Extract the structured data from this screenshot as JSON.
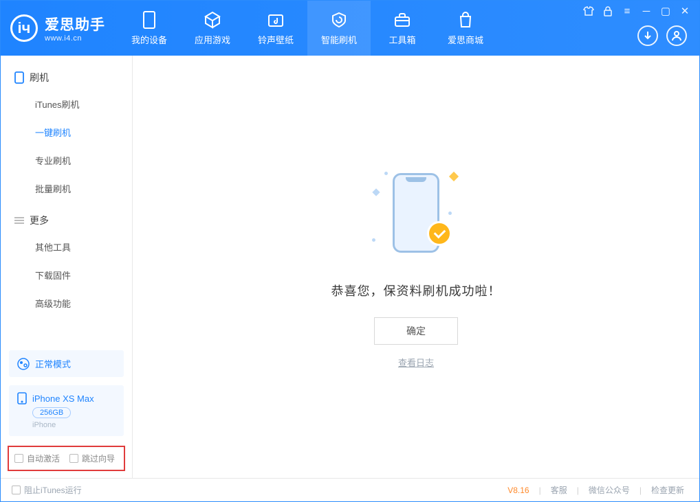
{
  "brand": {
    "title": "爱思助手",
    "sub": "www.i4.cn"
  },
  "nav": {
    "items": [
      {
        "label": "我的设备"
      },
      {
        "label": "应用游戏"
      },
      {
        "label": "铃声壁纸"
      },
      {
        "label": "智能刷机"
      },
      {
        "label": "工具箱"
      },
      {
        "label": "爱思商城"
      }
    ],
    "active_index": 3
  },
  "sidebar": {
    "sec1": "刷机",
    "items1": [
      "iTunes刷机",
      "一键刷机",
      "专业刷机",
      "批量刷机"
    ],
    "active1": 1,
    "sec2": "更多",
    "items2": [
      "其他工具",
      "下载固件",
      "高级功能"
    ]
  },
  "mode": {
    "label": "正常模式"
  },
  "device": {
    "name": "iPhone XS Max",
    "storage": "256GB",
    "type": "iPhone"
  },
  "options": {
    "auto_activate": "自动激活",
    "skip_guide": "跳过向导"
  },
  "main": {
    "success": "恭喜您，保资料刷机成功啦！",
    "ok": "确定",
    "log": "查看日志"
  },
  "footer": {
    "block_itunes": "阻止iTunes运行",
    "version": "V8.16",
    "links": [
      "客服",
      "微信公众号",
      "检查更新"
    ]
  }
}
